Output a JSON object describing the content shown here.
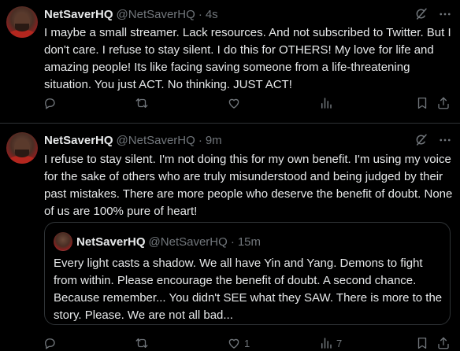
{
  "colors": {
    "background": "#000000",
    "text": "#e7e9ea",
    "secondary": "#71767b",
    "border": "#2f3336"
  },
  "tweets": [
    {
      "name": "NetSaverHQ",
      "handle": "@NetSaverHQ",
      "separator": "·",
      "time": "4s",
      "text": "I maybe a small streamer. Lack resources. And not subscribed to Twitter. But I don't care. I refuse to stay silent. I do this for OTHERS! My love for life and amazing people! Its like facing saving someone from a life-threatening situation. You just ACT. No thinking. JUST ACT!",
      "actions": {
        "likes": "",
        "views": ""
      }
    },
    {
      "name": "NetSaverHQ",
      "handle": "@NetSaverHQ",
      "separator": "·",
      "time": "9m",
      "text": "I refuse to stay silent. I'm not doing this for my own benefit. I'm using my voice for the sake of others who are truly misunderstood and being judged by their past mistakes. There are more people who deserve the benefit of doubt. None of us are 100% pure of heart!",
      "quote": {
        "name": "NetSaverHQ",
        "handle": "@NetSaverHQ",
        "separator": "·",
        "time": "15m",
        "text": "Every light casts a shadow. We all have Yin and Yang. Demons to fight from within. Please encourage the benefit of doubt. A second chance. Because remember... You didn't SEE what they SAW. There is more to the story. Please. We are not all bad..."
      },
      "actions": {
        "likes": "1",
        "views": "7"
      }
    }
  ],
  "icons": {
    "grok": "grok-icon",
    "more": "more-icon",
    "reply": "reply-icon",
    "retweet": "retweet-icon",
    "like": "like-icon",
    "views": "views-icon",
    "bookmark": "bookmark-icon",
    "share": "share-icon"
  }
}
